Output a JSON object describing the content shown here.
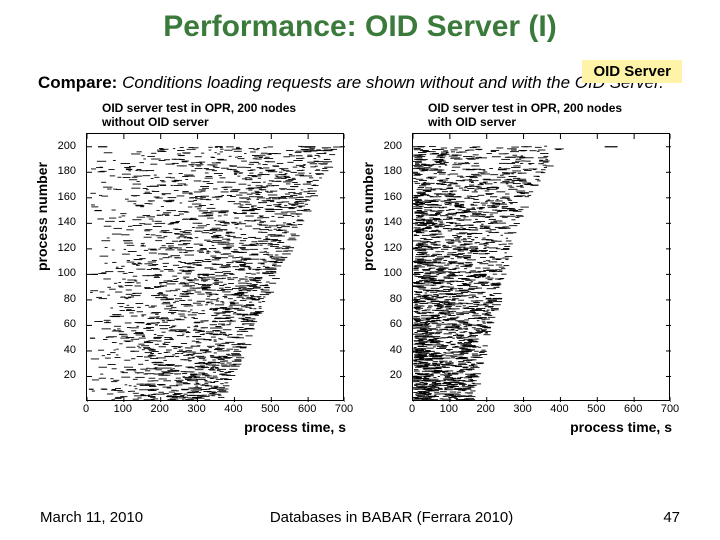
{
  "title": "Performance: OID Server (I)",
  "badge": "OID Server",
  "compare_label": "Compare:",
  "compare_text": "Conditions loading requests are shown without and with the OID Server.",
  "footer": {
    "date": "March 11, 2010",
    "venue": "Databases in BABAR (Ferrara 2010)",
    "page": "47"
  },
  "chart_data": [
    {
      "type": "scatter",
      "title": "OID server test in OPR, 200 nodes\nwithout OID server",
      "xlabel": "process time, s",
      "ylabel": "process number",
      "xlim": [
        0,
        700
      ],
      "ylim": [
        0,
        210
      ],
      "xticks": [
        0,
        100,
        200,
        300,
        400,
        500,
        600,
        700
      ],
      "yticks": [
        20,
        40,
        60,
        80,
        100,
        120,
        140,
        160,
        180,
        200
      ],
      "note": "Each process emits short horizontal request bursts. Activity is strongly triangular: process n spans roughly x≈0 to x≈350+1.6n (up to ~650s for process 200). Heavy density at low x, thinning toward the upper edge.",
      "segments_sample": [
        {
          "proc": 10,
          "t0": 5,
          "t1": 18
        },
        {
          "proc": 10,
          "t0": 40,
          "t1": 55
        },
        {
          "proc": 50,
          "t0": 8,
          "t1": 22
        },
        {
          "proc": 50,
          "t0": 180,
          "t1": 200
        },
        {
          "proc": 100,
          "t0": 12,
          "t1": 30
        },
        {
          "proc": 100,
          "t0": 300,
          "t1": 330
        },
        {
          "proc": 150,
          "t0": 20,
          "t1": 40
        },
        {
          "proc": 150,
          "t0": 420,
          "t1": 455
        },
        {
          "proc": 200,
          "t0": 30,
          "t1": 55
        },
        {
          "proc": 200,
          "t0": 580,
          "t1": 620
        }
      ]
    },
    {
      "type": "scatter",
      "title": "OID server test in OPR, 200 nodes\nwith OID server",
      "xlabel": "process time, s",
      "ylabel": "process number",
      "xlim": [
        0,
        700
      ],
      "ylim": [
        0,
        210
      ],
      "xticks": [
        0,
        100,
        200,
        300,
        400,
        500,
        600,
        700
      ],
      "yticks": [
        20,
        40,
        60,
        80,
        100,
        120,
        140,
        160,
        180,
        200
      ],
      "note": "Same axes. With OID server the bulk of activity compresses leftward: most processes finish requests by x≈250–350s. A sparse triangular tail of later bursts still reaches ~600s for process 200, but with far fewer points than the left chart.",
      "segments_sample": [
        {
          "proc": 10,
          "t0": 4,
          "t1": 14
        },
        {
          "proc": 10,
          "t0": 25,
          "t1": 34
        },
        {
          "proc": 50,
          "t0": 6,
          "t1": 16
        },
        {
          "proc": 50,
          "t0": 120,
          "t1": 135
        },
        {
          "proc": 100,
          "t0": 8,
          "t1": 20
        },
        {
          "proc": 100,
          "t0": 180,
          "t1": 200
        },
        {
          "proc": 150,
          "t0": 10,
          "t1": 24
        },
        {
          "proc": 150,
          "t0": 260,
          "t1": 285
        },
        {
          "proc": 200,
          "t0": 14,
          "t1": 30
        },
        {
          "proc": 200,
          "t0": 520,
          "t1": 555
        }
      ]
    }
  ]
}
